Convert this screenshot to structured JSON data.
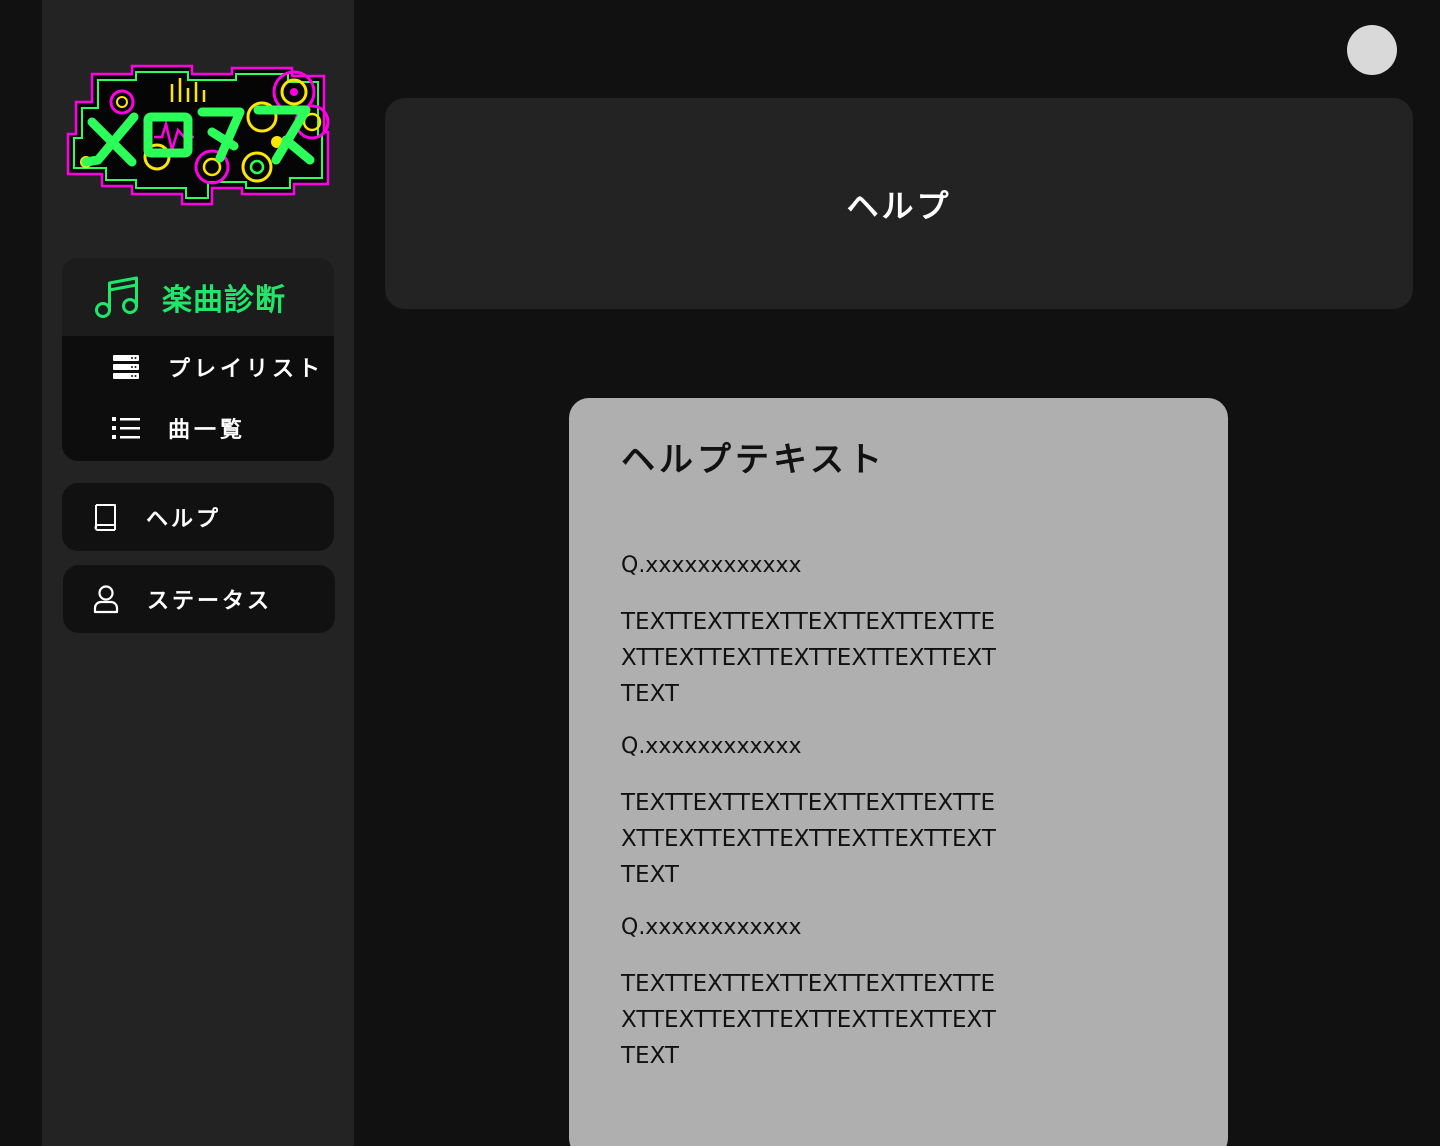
{
  "sidebar": {
    "logo_text": "メロタス",
    "nav_group": {
      "main": {
        "label": "楽曲診断",
        "icon": "music-note-icon"
      },
      "items": [
        {
          "label": "プレイリスト",
          "icon": "playlist-stack-icon"
        },
        {
          "label": "曲一覧",
          "icon": "list-icon"
        }
      ]
    },
    "help": {
      "label": "ヘルプ",
      "icon": "book-icon"
    },
    "status": {
      "label": "ステータス",
      "icon": "user-icon"
    }
  },
  "header": {
    "title": "ヘルプ"
  },
  "help_panel": {
    "title": "ヘルプテキスト",
    "faqs": [
      {
        "q": "Q.xxxxxxxxxxxx",
        "a": "TEXTTEXTTEXTTEXTTEXTTEXTTEXTTEXTTEXTTEXTTEXTTEXTTEXTTEXT"
      },
      {
        "q": "Q.xxxxxxxxxxxx",
        "a": "TEXTTEXTTEXTTEXTTEXTTEXTTEXTTEXTTEXTTEXTTEXTTEXTTEXTTEXT"
      },
      {
        "q": "Q.xxxxxxxxxxxx",
        "a": "TEXTTEXTTEXTTEXTTEXTTEXTTEXTTEXTTEXTTEXTTEXTTEXTTEXTTEXT"
      }
    ]
  },
  "colors": {
    "accent_green": "#1ee86a",
    "sidebar_bg": "#232323",
    "panel_bg": "#afafaf"
  }
}
